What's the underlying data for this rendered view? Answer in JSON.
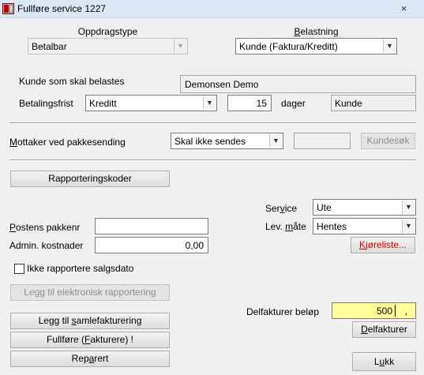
{
  "window": {
    "title": "Fullføre service 1227",
    "close_icon": "×"
  },
  "oppdragstype": {
    "label": "Oppdragstype",
    "value": "Betalbar"
  },
  "belastning": {
    "label_pre": "",
    "label_u": "B",
    "label_post": "elastning",
    "value": "Kunde (Faktura/Kreditt)"
  },
  "kunde": {
    "label": "Kunde som skal belastes",
    "value": "Demonsen Demo"
  },
  "betalingsfrist": {
    "label": "Betalingsfrist",
    "type_value": "Kreditt",
    "days_value": "15",
    "days_unit": "dager",
    "basis_value": "Kunde"
  },
  "mottaker": {
    "label_u": "M",
    "label_rest": "ottaker ved pakkesending",
    "value": "Skal ikke sendes",
    "extra_value": "",
    "kundesok_label": "Kundesøk"
  },
  "rapporteringskoder": {
    "label": "Rapporteringskoder"
  },
  "service": {
    "label_pre": "Ser",
    "label_u": "v",
    "label_post": "ice",
    "value": "Ute"
  },
  "lev_mate": {
    "label_pre": "Lev. ",
    "label_u": "m",
    "label_post": "åte",
    "value": "Hentes"
  },
  "kjoreliste": {
    "label_u": "K",
    "label_rest": "jøreliste..."
  },
  "postens_pakkenr": {
    "label_u": "P",
    "label_rest": "ostens pakkenr",
    "value": ""
  },
  "admin_kostnader": {
    "label": "Admin. kostnader",
    "value": "0,00"
  },
  "ikke_rapportere": {
    "label": "Ikke rapportere salgsdato",
    "checked": false
  },
  "buttons": {
    "legg_til_elektronisk": "Legg til elektronisk rapportering",
    "samle_pre": "Legg til ",
    "samle_u": "s",
    "samle_post": "amlefakturering",
    "fullfore_pre": "Fullføre (",
    "fullfore_u": "F",
    "fullfore_post": "akturere) !",
    "reparert_pre": "Rep",
    "reparert_u": "a",
    "reparert_post": "rert",
    "delfakturer_u": "D",
    "delfakturer_rest": "elfakturer",
    "lukk_pre": "L",
    "lukk_u": "u",
    "lukk_post": "kk"
  },
  "delfakturer": {
    "label": "Delfakturer beløp",
    "value": "500",
    "decimal": ","
  },
  "colors": {
    "highlight": "#ffff99",
    "kjoreliste_text": "#d00000"
  }
}
